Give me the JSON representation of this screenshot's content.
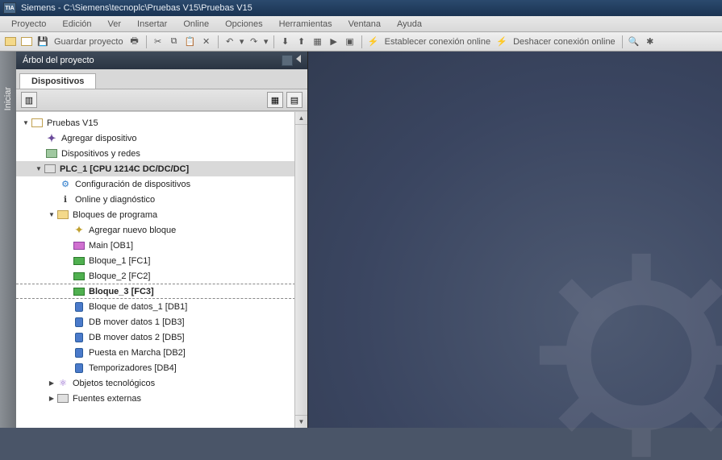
{
  "title": "Siemens - C:\\Siemens\\tecnoplc\\Pruebas V15\\Pruebas V15",
  "menu": [
    "Proyecto",
    "Edición",
    "Ver",
    "Insertar",
    "Online",
    "Opciones",
    "Herramientas",
    "Ventana",
    "Ayuda"
  ],
  "toolbar": {
    "save_label": "Guardar proyecto",
    "go_online_label": "Establecer conexión online",
    "go_offline_label": "Deshacer conexión online"
  },
  "rail": {
    "start": "Iniciar"
  },
  "panel": {
    "title": "Árbol del proyecto",
    "tab": "Dispositivos"
  },
  "tree": {
    "root": "Pruebas V15",
    "add_device": "Agregar dispositivo",
    "devices_networks": "Dispositivos y redes",
    "plc": "PLC_1 [CPU 1214C DC/DC/DC]",
    "device_config": "Configuración de dispositivos",
    "online_diag": "Online y diagnóstico",
    "program_blocks": "Bloques de programa",
    "add_block": "Agregar nuevo bloque",
    "main_ob": "Main [OB1]",
    "fc1": "Bloque_1 [FC1]",
    "fc2": "Bloque_2 [FC2]",
    "fc3": "Bloque_3 [FC3]",
    "db1": "Bloque de datos_1 [DB1]",
    "db3": "DB mover datos 1 [DB3]",
    "db5": "DB mover datos 2 [DB5]",
    "db2": "Puesta en Marcha [DB2]",
    "db4": "Temporizadores [DB4]",
    "tech_objects": "Objetos tecnológicos",
    "external_sources": "Fuentes externas"
  }
}
